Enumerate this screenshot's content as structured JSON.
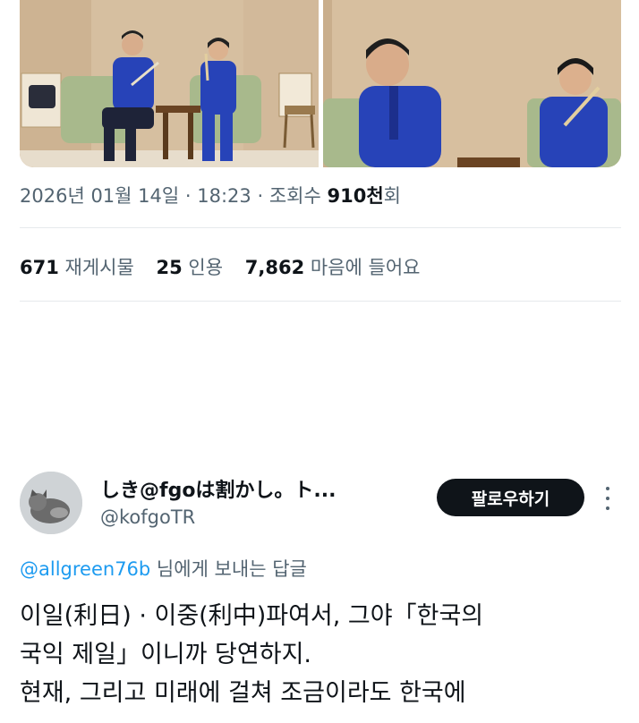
{
  "tweet": {
    "date": "2026년 01월 14일",
    "time": "18:23",
    "views_label": "조회수",
    "views_value": "910천",
    "views_suffix": "회",
    "stats": [
      {
        "value": "671",
        "label": "재게시물"
      },
      {
        "value": "25",
        "label": "인용"
      },
      {
        "value": "7,862",
        "label": "마음에 들어요"
      }
    ]
  },
  "reply": {
    "display_name": "しき@fgoは割かし。ト...",
    "handle": "@kofgoTR",
    "follow_label": "팔로우하기",
    "replying_to_handle": "@allgreen76b",
    "replying_to_suffix": " 님에게 보내는 답글",
    "lines": [
      "이일(利日) · 이중(利中)파여서, 그야「한국의",
      "국익 제일」이니까 당연하지.",
      "현재, 그리고 미래에 걸쳐 조금이라도 한국에"
    ]
  },
  "colors": {
    "text": "#0f1419",
    "secondary": "#536471",
    "link": "#1d9bf0",
    "follow_button": "#0f1419",
    "jacket_blue": "#2743b8"
  }
}
